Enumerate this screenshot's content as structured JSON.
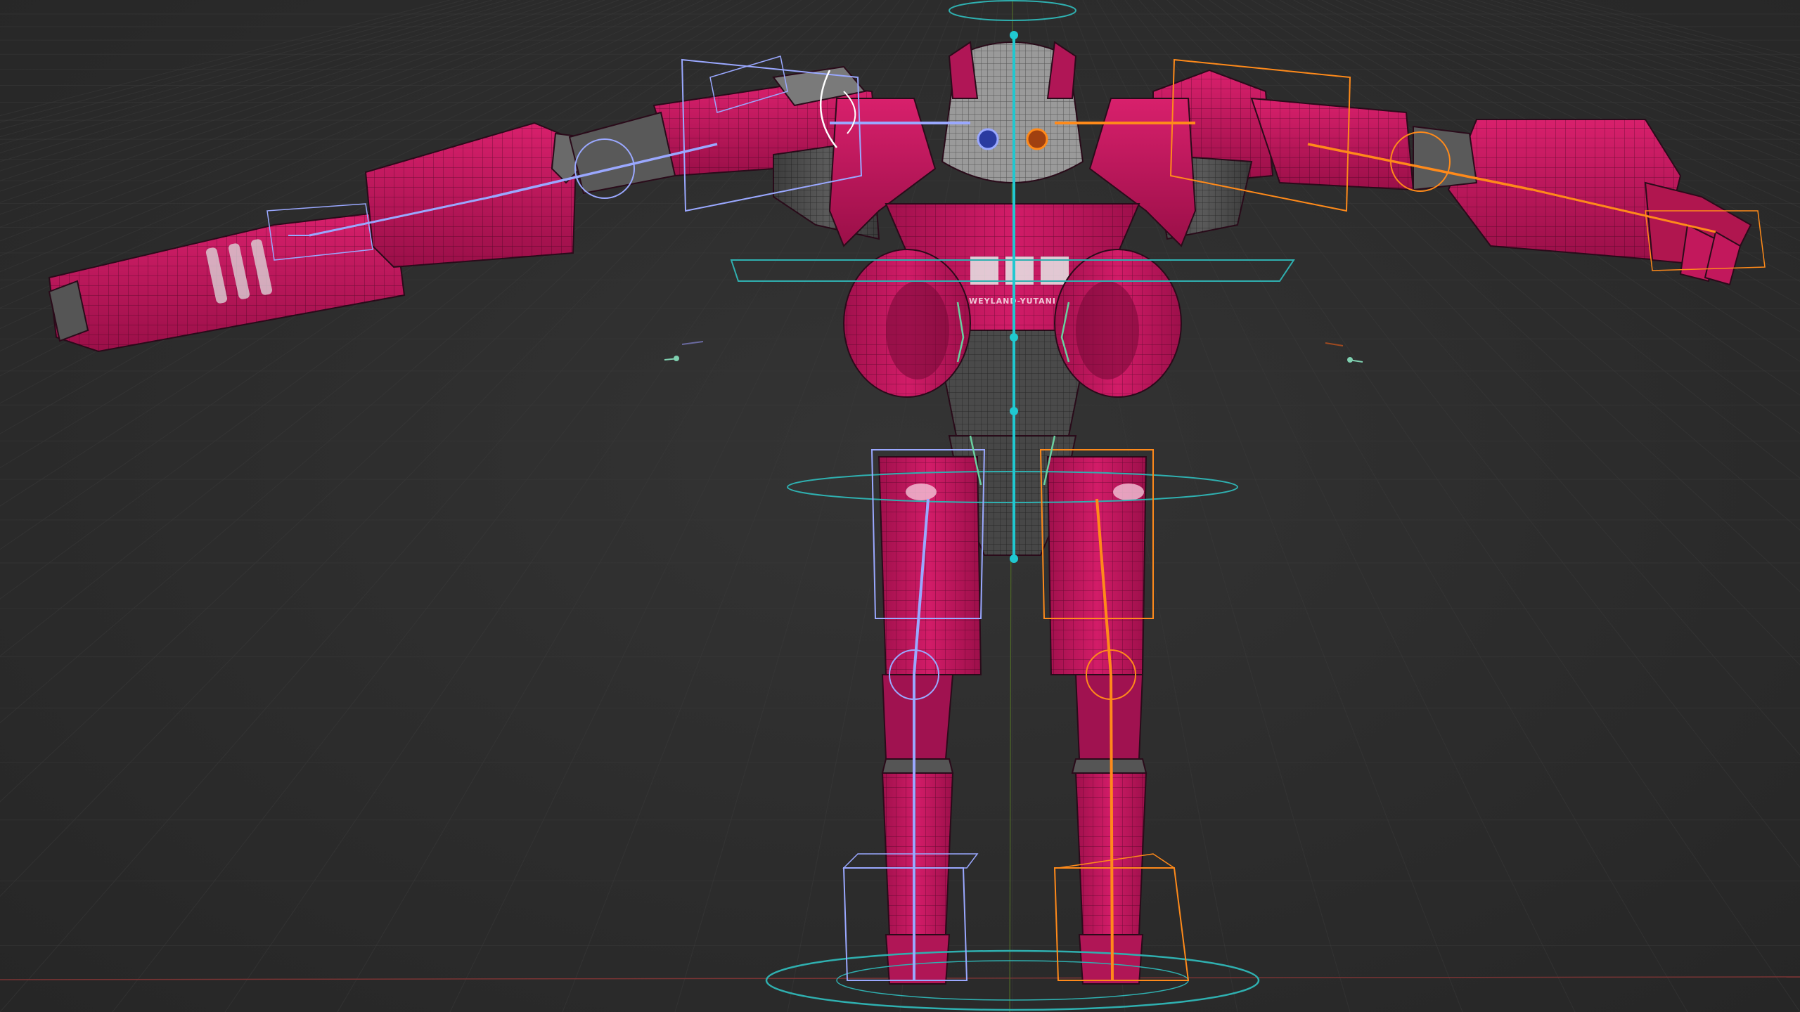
{
  "viewport": {
    "scene": "3d-viewport",
    "shading": "wireframe-overlay",
    "colors": {
      "background": "#2b2b2b",
      "grid": "#3a3a3a",
      "x_axis": "#8a3a3a",
      "y_axis": "#5b7a2a",
      "mesh_body": "#c8185f",
      "mesh_dark": "#4a4a4a",
      "bone_left": "#9aa8ff",
      "bone_right": "#ff8a1a",
      "bone_center": "#20c8d0",
      "control_ring": "#2fb0b0"
    }
  },
  "model": {
    "chest_logo_text": "WEYLAND-YUTANI"
  }
}
